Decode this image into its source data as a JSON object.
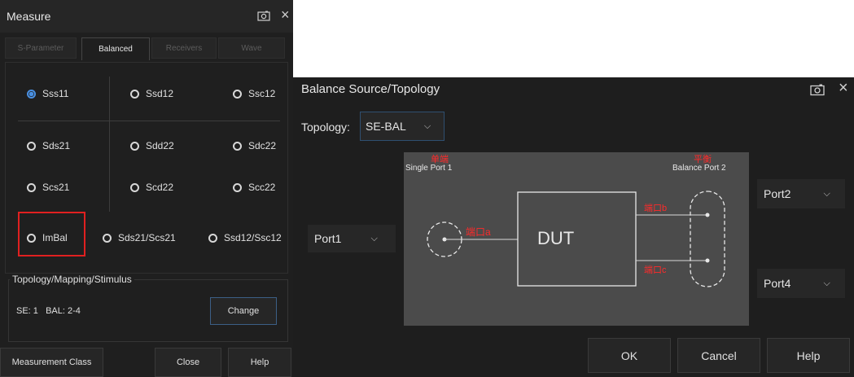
{
  "measure": {
    "title": "Measure",
    "tabs": [
      "S-Parameter",
      "Balanced",
      "Receivers",
      "Wave"
    ],
    "active_tab": "Balanced",
    "params": [
      "Sss11",
      "Ssd12",
      "Ssc12",
      "Sds21",
      "Sdd22",
      "Sdc22",
      "Scs21",
      "Scd22",
      "Scc22",
      "ImBal",
      "Sds21/Scs21",
      "Ssd12/Ssc12"
    ],
    "selected_param": "Sss11",
    "topology_group_label": "Topology/Mapping/Stimulus",
    "topology_value": "SE: 1   BAL: 2-4",
    "change_label": "Change",
    "measurement_class_label": "Measurement Class",
    "close_label": "Close",
    "help_label": "Help"
  },
  "balance": {
    "title": "Balance Source/Topology",
    "topology_label": "Topology:",
    "topology_value": "SE-BAL",
    "left_port": "Port1",
    "right_port_top": "Port2",
    "right_port_bottom": "Port4",
    "diagram": {
      "single_cn": "单端",
      "single_label": "Single Port 1",
      "balance_cn": "平衡",
      "balance_label": "Balance Port 2",
      "dut_label": "DUT",
      "port_a": "端口a",
      "port_b": "端口b",
      "port_c": "端口c"
    },
    "ok_label": "OK",
    "cancel_label": "Cancel",
    "help_label": "Help"
  },
  "colors": {
    "accent": "#4a90e2",
    "highlight": "#e02020",
    "annotation": "#ff2a2a"
  }
}
